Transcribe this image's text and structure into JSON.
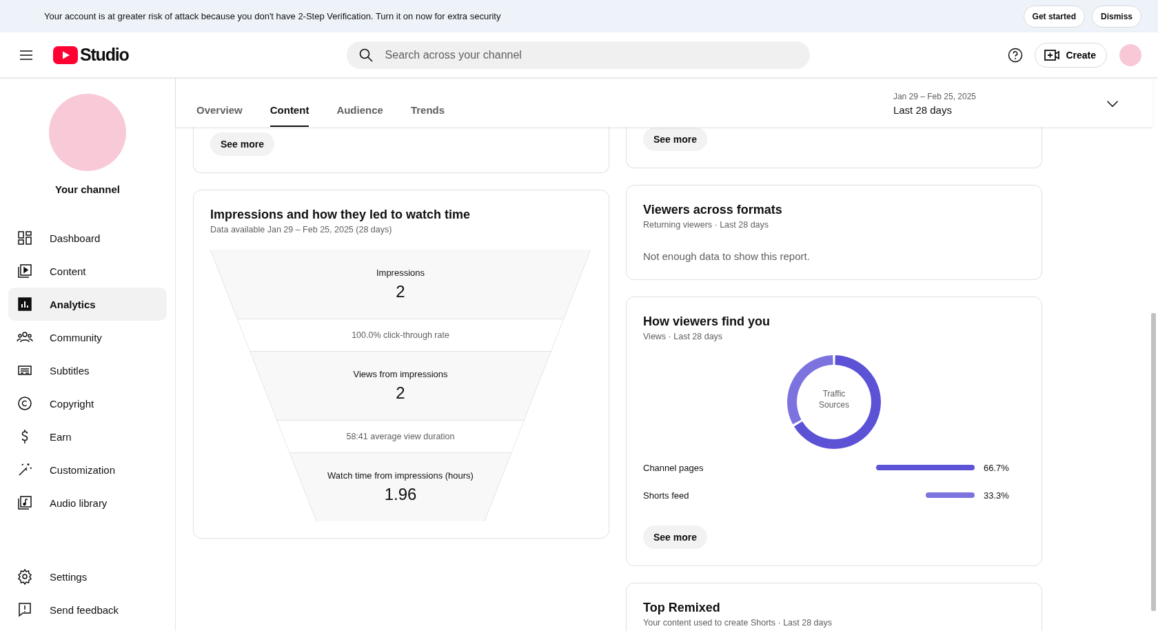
{
  "banner": {
    "message": "Your account is at greater risk of attack because you don't have 2-Step Verification. Turn it on now for extra security",
    "buttons": [
      "Get started",
      "Dismiss"
    ]
  },
  "header": {
    "logo_text": "Studio",
    "search": {
      "placeholder": "Search across your channel"
    },
    "create_label": "Create"
  },
  "sidebar": {
    "channel_label": "Your channel",
    "items": [
      {
        "label": "Dashboard",
        "selected": false
      },
      {
        "label": "Content",
        "selected": false
      },
      {
        "label": "Analytics",
        "selected": true
      },
      {
        "label": "Community",
        "selected": false
      },
      {
        "label": "Subtitles",
        "selected": false
      },
      {
        "label": "Copyright",
        "selected": false
      },
      {
        "label": "Earn",
        "selected": false
      },
      {
        "label": "Customization",
        "selected": false
      },
      {
        "label": "Audio library",
        "selected": false
      }
    ],
    "footer_items": [
      {
        "label": "Settings",
        "selected": false
      },
      {
        "label": "Send feedback",
        "selected": false
      }
    ]
  },
  "tabs": [
    {
      "label": "Overview",
      "selected": false
    },
    {
      "label": "Content",
      "selected": true
    },
    {
      "label": "Audience",
      "selected": false
    },
    {
      "label": "Trends",
      "selected": false
    }
  ],
  "date_range": {
    "dates": "Jan 29 – Feb 25, 2025",
    "label": "Last 28 days"
  },
  "left_column": {
    "partial_card": {
      "button": "See more"
    },
    "funnel_card": {
      "title": "Impressions and how they led to watch time",
      "subtitle": "Data available Jan 29 – Feb 25, 2025 (28 days)",
      "rows": [
        {
          "kind": "stage",
          "label": "Impressions",
          "value": "2"
        },
        {
          "kind": "rate",
          "text": "100.0% click-through rate"
        },
        {
          "kind": "stage",
          "label": "Views from impressions",
          "value": "2"
        },
        {
          "kind": "rate",
          "text": "58:41 average view duration"
        },
        {
          "kind": "stage",
          "label": "Watch time from impressions (hours)",
          "value": "1.96"
        }
      ]
    }
  },
  "right_column": {
    "partial_card": {
      "button": "See more"
    },
    "viewers_card": {
      "title": "Viewers across formats",
      "subtitle": "Returning viewers · Last 28 days",
      "message": "Not enough data to show this report."
    },
    "find_card": {
      "title": "How viewers find you",
      "subtitle": "Views · Last 28 days",
      "button": "See more",
      "chart_data": {
        "type": "donut",
        "title": "Traffic Sources",
        "values": [
          66.7,
          33.3
        ],
        "colors": [
          "#5b52d6",
          "#7c73df"
        ]
      },
      "traffic_sources": [
        {
          "name": "Channel pages",
          "percent": "66.7%"
        },
        {
          "name": "Shorts feed",
          "percent": "33.3%"
        }
      ]
    },
    "remix_card": {
      "title": "Top Remixed",
      "subtitle": "Your content used to create Shorts · Last 28 days"
    }
  }
}
